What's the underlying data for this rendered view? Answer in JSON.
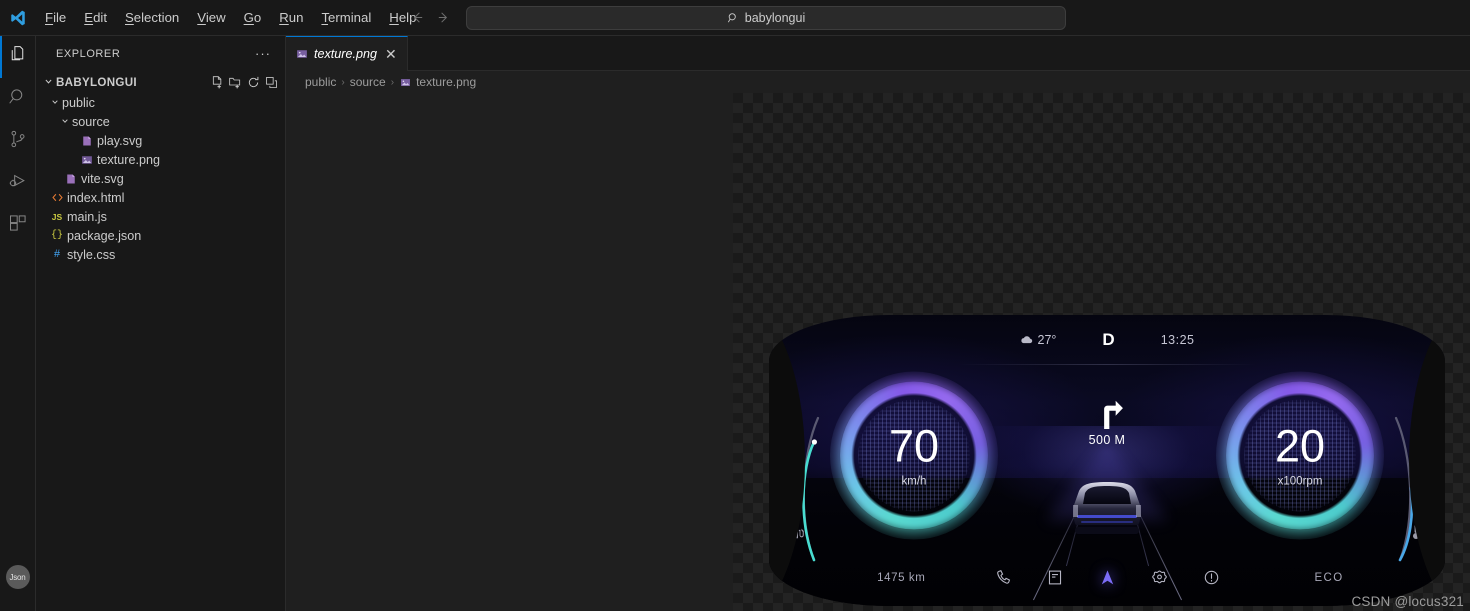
{
  "titlebar": {
    "logo_icon": "vscode-logo-icon",
    "menu": [
      {
        "label": "File",
        "accel": "F"
      },
      {
        "label": "Edit",
        "accel": "E"
      },
      {
        "label": "Selection",
        "accel": "S"
      },
      {
        "label": "View",
        "accel": "V"
      },
      {
        "label": "Go",
        "accel": "G"
      },
      {
        "label": "Run",
        "accel": "R"
      },
      {
        "label": "Terminal",
        "accel": "T"
      },
      {
        "label": "Help",
        "accel": "H"
      }
    ],
    "back_icon": "arrow-left-icon",
    "forward_icon": "arrow-right-icon",
    "command_center": {
      "icon": "search-icon",
      "value": "babylongui"
    }
  },
  "activitybar": {
    "items": [
      {
        "name": "explorer",
        "icon": "files-icon",
        "active": true
      },
      {
        "name": "search",
        "icon": "search-icon",
        "active": false
      },
      {
        "name": "source-control",
        "icon": "source-control-icon",
        "active": false
      },
      {
        "name": "run-and-debug",
        "icon": "run-debug-icon",
        "active": false
      },
      {
        "name": "extensions",
        "icon": "extensions-icon",
        "active": false
      }
    ],
    "account_badge": "Json"
  },
  "sidebar": {
    "title": "EXPLORER",
    "more_actions": "···",
    "root": {
      "label": "BABYLONGUI",
      "actions": [
        "new-file-icon",
        "new-folder-icon",
        "refresh-icon",
        "collapse-all-icon"
      ]
    },
    "tree": [
      {
        "label": "public",
        "type": "folder",
        "depth": 1,
        "expanded": true
      },
      {
        "label": "source",
        "type": "folder",
        "depth": 2,
        "expanded": true
      },
      {
        "label": "play.svg",
        "type": "svg",
        "depth": 3
      },
      {
        "label": "texture.png",
        "type": "image",
        "depth": 3,
        "selected": false
      },
      {
        "label": "vite.svg",
        "type": "svg",
        "depth": 2
      },
      {
        "label": "index.html",
        "type": "html",
        "depth": 1
      },
      {
        "label": "main.js",
        "type": "js",
        "depth": 1
      },
      {
        "label": "package.json",
        "type": "json",
        "depth": 1
      },
      {
        "label": "style.css",
        "type": "css",
        "depth": 1
      }
    ]
  },
  "editor": {
    "tab": {
      "label": "texture.png",
      "icon": "image-file-icon",
      "close_icon": "close-icon"
    },
    "breadcrumb": [
      "public",
      "source",
      "texture.png"
    ],
    "breadcrumb_separator": "›"
  },
  "preview": {
    "watermark": "CSDN @locus321",
    "dashboard": {
      "status": {
        "weather_icon": "cloud-icon",
        "temperature": "27°",
        "gear": "D",
        "time": "13:25"
      },
      "navigation": {
        "turn_icon": "turn-right-icon",
        "distance": "500 M"
      },
      "speedometer": {
        "value": "70",
        "unit": "km/h"
      },
      "tachometer": {
        "value": "20",
        "unit": "x100rpm"
      },
      "fuel_icon": "fuel-pump-icon",
      "temp_icon": "thermometer-icon",
      "bottom": {
        "odometer": "1475 km",
        "drive_mode": "ECO",
        "icons": [
          {
            "name": "phone-icon",
            "active": false
          },
          {
            "name": "message-icon",
            "active": false
          },
          {
            "name": "navigation-arrow-icon",
            "active": true
          },
          {
            "name": "settings-gear-icon",
            "active": false
          },
          {
            "name": "warning-icon",
            "active": false
          }
        ]
      }
    }
  },
  "colors": {
    "accent": "#0078d4",
    "titlebar_bg": "#181818",
    "editor_bg": "#1f1f1f",
    "gauge_cyan": "#5de2d8",
    "gauge_violet": "#8a5cf0",
    "nav_highlight": "#7b6cf6"
  }
}
